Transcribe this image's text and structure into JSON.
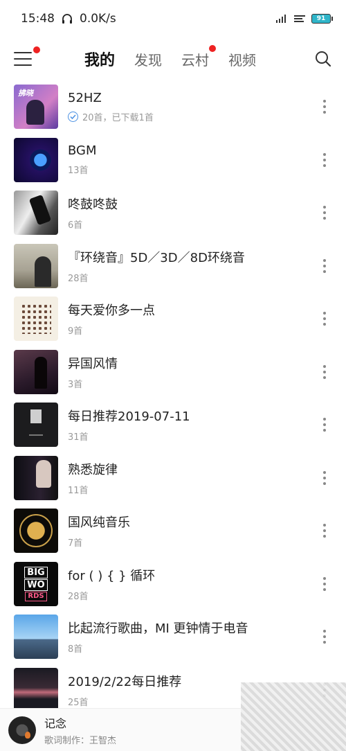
{
  "status_bar": {
    "time": "15:48",
    "net_speed": "0.0K/s",
    "battery": "91"
  },
  "nav": {
    "tabs": [
      {
        "label": "我的"
      },
      {
        "label": "发现"
      },
      {
        "label": "云村"
      },
      {
        "label": "视频"
      }
    ]
  },
  "playlists": [
    {
      "title": "52HZ",
      "subtitle": "20首，已下载1首"
    },
    {
      "title": "BGM",
      "subtitle": "13首"
    },
    {
      "title": "咚鼓咚鼓",
      "subtitle": "6首"
    },
    {
      "title": "『环绕音』5D／3D／8D环绕音",
      "subtitle": "28首"
    },
    {
      "title": "每天爱你多一点",
      "subtitle": "9首"
    },
    {
      "title": "异国风情",
      "subtitle": "3首"
    },
    {
      "title": "每日推荐2019-07-11",
      "subtitle": "31首"
    },
    {
      "title": "熟悉旋律",
      "subtitle": "11首"
    },
    {
      "title": "国风纯音乐",
      "subtitle": "7首"
    },
    {
      "title": "for ( ) { } 循环",
      "subtitle": "28首"
    },
    {
      "title": "比起流行歌曲，MI 更钟情于电音",
      "subtitle": "8首"
    },
    {
      "title": "2019/2/22每日推荐",
      "subtitle": "25首"
    }
  ],
  "cover_text": {
    "c1": "拂晓",
    "c10_line1": "BIG",
    "c10_line2": "WO",
    "c10_line3": "RDS"
  },
  "mini_player": {
    "title": "记念",
    "lyric": "歌词制作：王智杰"
  },
  "colors": {
    "accent_red": "#e22222",
    "download_blue": "#4a90e2"
  }
}
